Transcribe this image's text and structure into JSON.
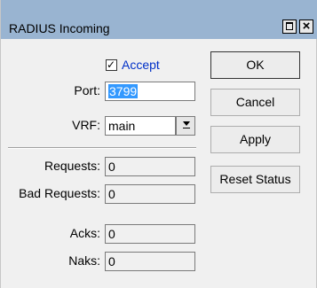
{
  "window": {
    "title": "RADIUS Incoming",
    "maximize_icon": "maximize-icon",
    "close_icon": "close-icon",
    "close_glyph": "×"
  },
  "form": {
    "accept": {
      "label": "Accept",
      "checked": true,
      "check_glyph": "✓"
    },
    "port": {
      "label": "Port:",
      "value": "3799"
    },
    "vrf": {
      "label": "VRF:",
      "value": "main"
    },
    "requests": {
      "label": "Requests:",
      "value": "0"
    },
    "bad_requests": {
      "label": "Bad Requests:",
      "value": "0"
    },
    "acks": {
      "label": "Acks:",
      "value": "0"
    },
    "naks": {
      "label": "Naks:",
      "value": "0"
    }
  },
  "buttons": {
    "ok": "OK",
    "cancel": "Cancel",
    "apply": "Apply",
    "reset_status": "Reset Status"
  },
  "colors": {
    "titlebar": "#99b4d1",
    "accept_label": "#0030c8",
    "selection": "#3399ff"
  }
}
